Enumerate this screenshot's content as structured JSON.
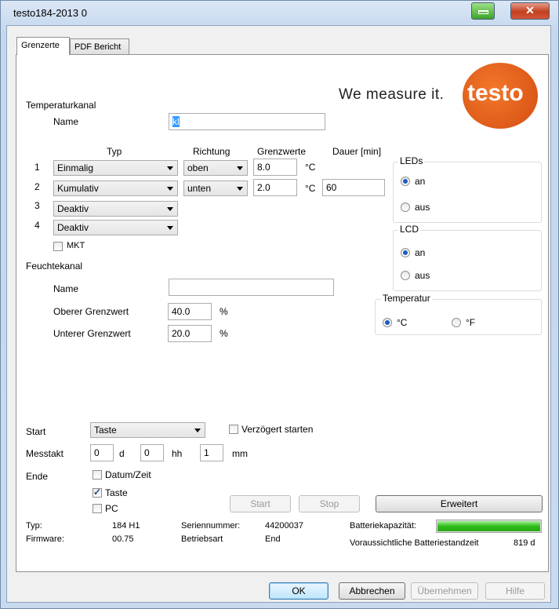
{
  "window": {
    "title": "testo184-2013 0"
  },
  "tabs": [
    {
      "label": "Grenzerte"
    },
    {
      "label": "PDF Bericht"
    }
  ],
  "logo": {
    "slogan": "We measure it.",
    "brand": "testo"
  },
  "temp": {
    "section": "Temperaturkanal",
    "name_label": "Name",
    "name_value": "kl",
    "headers": {
      "typ": "Typ",
      "richtung": "Richtung",
      "grenzwerte": "Grenzwerte",
      "dauer": "Dauer [min]"
    },
    "rows": [
      {
        "num": "1",
        "typ": "Einmalig",
        "richtung": "oben",
        "grenz": "8.0",
        "unit": "°C",
        "dauer": ""
      },
      {
        "num": "2",
        "typ": "Kumulativ",
        "richtung": "unten",
        "grenz": "2.0",
        "unit": "°C",
        "dauer": "60"
      },
      {
        "num": "3",
        "typ": "Deaktiv"
      },
      {
        "num": "4",
        "typ": "Deaktiv"
      }
    ],
    "mkt": "MKT"
  },
  "humid": {
    "section": "Feuchtekanal",
    "name_label": "Name",
    "name_value": "",
    "upper_label": "Oberer Grenzwert",
    "upper_value": "40.0",
    "upper_unit": "%",
    "lower_label": "Unterer Grenzwert",
    "lower_value": "20.0",
    "lower_unit": "%"
  },
  "leds": {
    "title": "LEDs",
    "on": "an",
    "off": "aus",
    "selected": "an"
  },
  "lcd": {
    "title": "LCD",
    "on": "an",
    "off": "aus",
    "selected": "an"
  },
  "temperatur": {
    "title": "Temperatur",
    "c": "°C",
    "f": "°F",
    "selected": "°C"
  },
  "start": {
    "label": "Start",
    "value": "Taste",
    "delayed": "Verzögert starten",
    "delayed_checked": false
  },
  "messtakt": {
    "label": "Messtakt",
    "d_value": "0",
    "d_unit": "d",
    "hh_value": "0",
    "hh_unit": "hh",
    "mm_value": "1",
    "mm_unit": "mm"
  },
  "ende": {
    "label": "Ende",
    "options": [
      {
        "label": "Datum/Zeit",
        "checked": false
      },
      {
        "label": "Taste",
        "checked": true
      },
      {
        "label": "PC",
        "checked": false
      }
    ]
  },
  "actions": {
    "start": "Start",
    "stop": "Stop",
    "erweitert": "Erweitert"
  },
  "info": {
    "typ_label": "Typ:",
    "typ_value": "184 H1",
    "firmware_label": "Firmware:",
    "firmware_value": "00.75",
    "serial_label": "Seriennummer:",
    "serial_value": "44200037",
    "mode_label": "Betriebsart",
    "mode_value": "End",
    "battery_label": "Batteriekapazität:",
    "battery_level": 1.0,
    "battery_life_label": "Voraussichtliche Batteriestandzeit",
    "battery_life_value": "819 d"
  },
  "dialog": {
    "ok": "OK",
    "cancel": "Abbrechen",
    "apply": "Übernehmen",
    "help": "Hilfe"
  },
  "colors": {
    "accent": "#e2601e",
    "battery": "#2fbd1b",
    "radio": "#1d5bc4"
  }
}
